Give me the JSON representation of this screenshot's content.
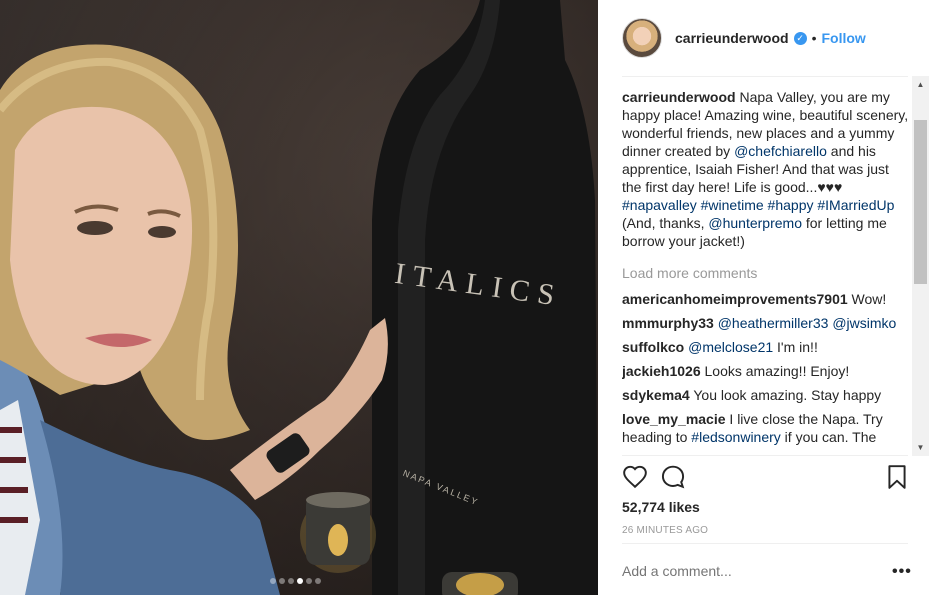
{
  "post": {
    "username": "carrieunderwood",
    "follow_label": "Follow",
    "bullet": "•",
    "verified_glyph": "✓",
    "photo": {
      "bottle_label": "ITALICS",
      "dots_total": 6,
      "dots_active_index": 3
    },
    "caption": {
      "user": "carrieunderwood",
      "t1": " Napa Valley, you are my happy place! Amazing wine, beautiful scenery, wonderful friends, new places and a yummy dinner created by ",
      "mention1": "@chefchiarello",
      "t2": " and his apprentice, Isaiah Fisher! And that was just the first day here! Life is good...♥♥♥ ",
      "tag1": "#napavalley",
      "tag2": "#winetime",
      "tag3": "#happy",
      "tag4": "#IMarriedUp",
      "t3": " (And, thanks, ",
      "mention2": "@hunterpremo",
      "t4": " for letting me borrow your jacket!)"
    },
    "load_more": "Load more comments",
    "comments": [
      {
        "user": "americanhomeimprovements7901",
        "text": " Wow!"
      },
      {
        "user": "mmmurphy33",
        "link1": "@heathermiller33",
        "link2": "@jwsimko"
      },
      {
        "user": "suffolkco",
        "link1": "@melclose21",
        "text": " I'm in!!"
      },
      {
        "user": "jackieh1026",
        "text": " Looks amazing!! Enjoy!"
      },
      {
        "user": "sdykema4",
        "text": " You look amazing. Stay happy"
      },
      {
        "user": "love_my_macie",
        "text": " I live close the Napa. Try heading to ",
        "link1": "#ledsonwinery",
        "text2": " if you can. The"
      }
    ],
    "likes": "52,774 likes",
    "time": "26 MINUTES AGO",
    "add_comment_placeholder": "Add a comment...",
    "more_label": "•••",
    "icons": {
      "like": "heart-icon",
      "comment": "comment-bubble-icon",
      "save": "bookmark-icon"
    },
    "scrollbar": {
      "up": "▲",
      "down": "▼"
    },
    "colors": {
      "link": "#003569",
      "accent": "#3897f0",
      "muted": "#999999"
    }
  }
}
